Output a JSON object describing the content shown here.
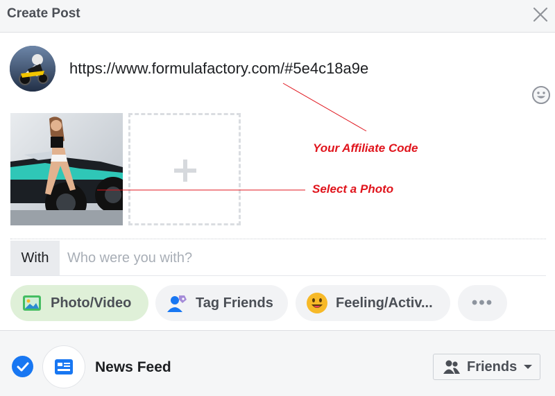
{
  "header": {
    "title": "Create Post",
    "close_icon": "close-icon"
  },
  "composer": {
    "avatar_icon": "avatar-motorcycle-rider",
    "text": "https://www.formulafactory.com/#5e4c18a9e",
    "emoji_icon": "smiley-icon"
  },
  "media": {
    "thumbnail_icon": "photo-thumbnail",
    "add_icon": "plus-icon"
  },
  "annotations": {
    "affiliate_code": "Your Affiliate Code",
    "select_photo": "Select a Photo",
    "color": "#e0141c"
  },
  "with": {
    "label": "With",
    "placeholder": "Who were you with?"
  },
  "actions": {
    "photo_video": "Photo/Video",
    "tag_friends": "Tag Friends",
    "feeling": "Feeling/Activ...",
    "more": "•••"
  },
  "footer": {
    "news_feed": "News Feed",
    "audience": "Friends",
    "accent": "#1877f2"
  }
}
